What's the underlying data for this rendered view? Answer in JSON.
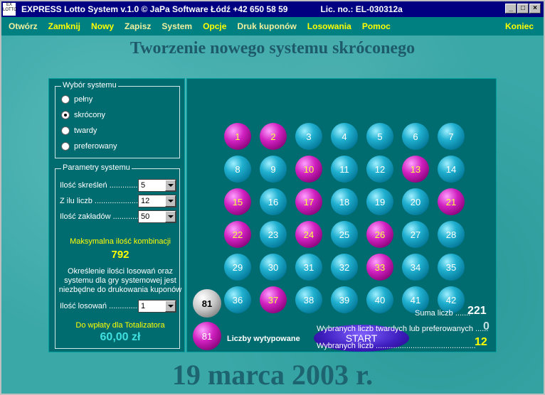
{
  "window": {
    "icon_line1": "EX",
    "icon_line2": "LOTTO",
    "title": "EXPRESS Lotto System v.1.0  © JaPa Software Łódź +42 650 58 59",
    "license": "Lic. no.: EL-030312a",
    "btn_min": "_",
    "btn_max": "□",
    "btn_close": "×"
  },
  "menu": {
    "items": [
      "Otwórz",
      "Zamknij",
      "Nowy",
      "Zapisz",
      "System",
      "Opcje",
      "Druk kuponów",
      "Losowania",
      "Pomoc"
    ],
    "end": "Koniec"
  },
  "page_title": "Tworzenie nowego systemu skróconego",
  "date": "19 marca 2003 r.",
  "system_choice": {
    "title": "Wybór systemu",
    "options": [
      "pełny",
      "skrócony",
      "twardy",
      "preferowany"
    ],
    "selected_index": 1
  },
  "params": {
    "title": "Parametry systemu",
    "rows": [
      {
        "label": "Ilość skreśleń ..............",
        "value": "5"
      },
      {
        "label": "Z ilu liczb ....................",
        "value": "12"
      },
      {
        "label": "Ilość zakładów ............",
        "value": "50"
      }
    ],
    "max_label": "Maksymalna ilość kombinacji",
    "max_value": "792",
    "note": "Określenie ilości losowań oraz systemu dla gry systemowej jest niezbędne do drukowania kuponów",
    "draws_label": "Ilość losowań ..............",
    "draws_value": "1",
    "pay_label": "Do wpłaty dla Totalizatora",
    "pay_value": "60,00 zł"
  },
  "board": {
    "numbers": [
      1,
      2,
      3,
      4,
      5,
      6,
      7,
      8,
      9,
      10,
      11,
      12,
      13,
      14,
      15,
      16,
      17,
      18,
      19,
      20,
      21,
      22,
      23,
      24,
      25,
      26,
      27,
      28,
      29,
      30,
      31,
      32,
      33,
      34,
      35,
      36,
      37,
      38,
      39,
      40,
      41,
      42
    ],
    "selected": [
      1,
      2,
      10,
      13,
      15,
      17,
      21,
      22,
      24,
      26,
      33,
      37
    ],
    "colors": {
      "normal": "#20b0d0",
      "selected": "#d020c0",
      "selected_text": "#ffff40"
    }
  },
  "summary": {
    "white_ball": "81",
    "pink_ball": "81",
    "legend": "Liczby wytypowane",
    "start": "START",
    "sum_label": "Suma liczb .......",
    "sum_value": "221",
    "hard_label": "Wybranych liczb twardych lub preferowanych ......",
    "hard_value": "0",
    "chosen_label": "Wybranych liczb ..............................................",
    "chosen_value": "12"
  }
}
